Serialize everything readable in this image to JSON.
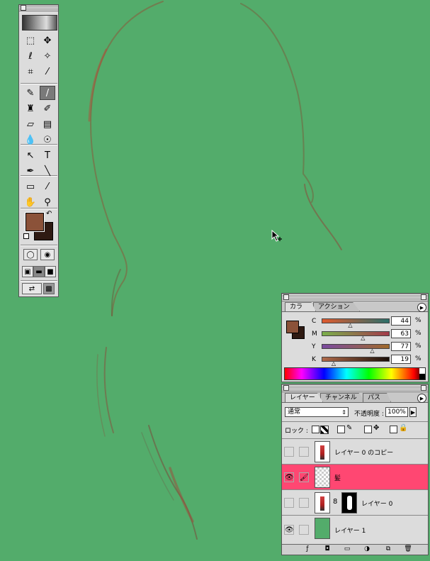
{
  "colors": {
    "canvas_bg": "#53ac6b",
    "foreground": "#8b5239",
    "background": "#2e1a12",
    "selected_layer": "#ff4772"
  },
  "toolbox": {
    "tools": [
      {
        "name": "marquee-tool-icon",
        "glyph": "⬚"
      },
      {
        "name": "move-tool-icon",
        "glyph": "✥"
      },
      {
        "name": "lasso-tool-icon",
        "glyph": "ℓ"
      },
      {
        "name": "magic-wand-tool-icon",
        "glyph": "✧"
      },
      {
        "name": "crop-tool-icon",
        "glyph": "⌗"
      },
      {
        "name": "slice-tool-icon",
        "glyph": "⁄"
      },
      {
        "name": "healing-brush-tool-icon",
        "glyph": "✎"
      },
      {
        "name": "brush-tool-icon",
        "glyph": "/"
      },
      {
        "name": "stamp-tool-icon",
        "glyph": "♜"
      },
      {
        "name": "history-brush-tool-icon",
        "glyph": "✐"
      },
      {
        "name": "eraser-tool-icon",
        "glyph": "▱"
      },
      {
        "name": "gradient-tool-icon",
        "glyph": "▤"
      },
      {
        "name": "blur-tool-icon",
        "glyph": "💧"
      },
      {
        "name": "dodge-tool-icon",
        "glyph": "☉"
      },
      {
        "name": "path-select-tool-icon",
        "glyph": "↖"
      },
      {
        "name": "type-tool-icon",
        "glyph": "T"
      },
      {
        "name": "pen-tool-icon",
        "glyph": "✒"
      },
      {
        "name": "line-tool-icon",
        "glyph": "╲"
      },
      {
        "name": "notes-tool-icon",
        "glyph": "▭"
      },
      {
        "name": "eyedropper-tool-icon",
        "glyph": "⁄"
      },
      {
        "name": "hand-tool-icon",
        "glyph": "✋"
      },
      {
        "name": "zoom-tool-icon",
        "glyph": "⚲"
      }
    ],
    "selected_tool": "brush-tool-icon"
  },
  "color_panel": {
    "tabs": [
      "カラー",
      "アクション"
    ],
    "active_tab": "カラー",
    "channels": [
      {
        "label": "C",
        "value": "44",
        "pct": "%",
        "level": 0.44,
        "grad": "linear-gradient(90deg,#e05a2e,#2a6f6a)"
      },
      {
        "label": "M",
        "value": "63",
        "pct": "%",
        "level": 0.63,
        "grad": "linear-gradient(90deg,#7ab04a,#a33a4a)"
      },
      {
        "label": "Y",
        "value": "77",
        "pct": "%",
        "level": 0.77,
        "grad": "linear-gradient(90deg,#7a4aa0,#a06a2a)"
      },
      {
        "label": "K",
        "value": "19",
        "pct": "%",
        "level": 0.19,
        "grad": "linear-gradient(90deg,#b06a4a,#1a0e08)"
      }
    ]
  },
  "layers_panel": {
    "tabs": [
      "レイヤー",
      "チャンネル",
      "パス"
    ],
    "active_tab": "レイヤー",
    "blend_mode": "通常",
    "opacity_label": "不透明度 :",
    "opacity_value": "100%",
    "lock_label": "ロック :",
    "layers": [
      {
        "name": "レイヤー 0 のコピー",
        "visible": false,
        "selected": false
      },
      {
        "name": "髪",
        "visible": true,
        "selected": true
      },
      {
        "name": "レイヤー 0",
        "visible": false,
        "selected": false
      },
      {
        "name": "レイヤー 1",
        "visible": true,
        "selected": false
      }
    ],
    "eye_glyph": "👁",
    "brush_glyph": "🖌",
    "chain_glyph": "8"
  }
}
